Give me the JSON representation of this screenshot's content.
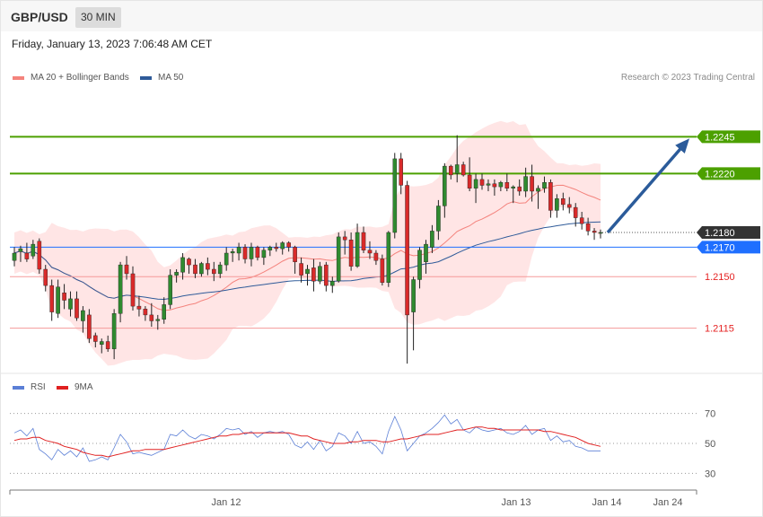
{
  "header": {
    "symbol": "GBP/USD",
    "timeframe": "30 MIN"
  },
  "datetime": "Friday, January 13, 2023 7:06:48 AM CET",
  "legend_main": [
    {
      "label": "MA 20 + Bollinger Bands",
      "color": "#f4837d"
    },
    {
      "label": "MA 50",
      "color": "#2f5b99"
    }
  ],
  "legend_rsi": [
    {
      "label": "RSI",
      "color": "#5b7fd6"
    },
    {
      "label": "9MA",
      "color": "#e02020"
    }
  ],
  "copyright": "Research © 2023 Trading Central",
  "colors": {
    "up": "#2f8a2f",
    "down": "#d92a2a",
    "resistance": "#4ca000",
    "pivot": "#333333",
    "current": "#1f6fff",
    "support": "#e52222",
    "band": "#ffe1e1",
    "arrow": "#2b5b9a"
  },
  "chart_data": [
    {
      "type": "candlestick",
      "ylim": [
        1.2088,
        1.2272
      ],
      "levels": [
        {
          "value": 1.2245,
          "label": "1.2245",
          "role": "resistance"
        },
        {
          "value": 1.222,
          "label": "1.2220",
          "role": "resistance"
        },
        {
          "value": 1.218,
          "label": "1.2180",
          "role": "pivot"
        },
        {
          "value": 1.217,
          "label": "1.2170",
          "role": "current"
        },
        {
          "value": 1.215,
          "label": "1.2150",
          "role": "support"
        },
        {
          "value": 1.2115,
          "label": "1.2115",
          "role": "support"
        }
      ],
      "x_ticks": [
        "Jan 12",
        "Jan 13",
        "Jan 14",
        "Jan 24"
      ],
      "forecast": {
        "from": 1.218,
        "to": 1.2245
      },
      "candles": [
        [
          1.2161,
          1.217,
          1.2157,
          1.2166
        ],
        [
          1.2167,
          1.2171,
          1.216,
          1.2169
        ],
        [
          1.2166,
          1.2173,
          1.216,
          1.2162
        ],
        [
          1.2164,
          1.2175,
          1.2162,
          1.2172
        ],
        [
          1.2174,
          1.2176,
          1.2152,
          1.2155
        ],
        [
          1.2155,
          1.2158,
          1.214,
          1.2144
        ],
        [
          1.2144,
          1.2148,
          1.212,
          1.2126
        ],
        [
          1.2125,
          1.2148,
          1.2122,
          1.2143
        ],
        [
          1.2139,
          1.2145,
          1.2128,
          1.2134
        ],
        [
          1.2128,
          1.214,
          1.2123,
          1.2135
        ],
        [
          1.2135,
          1.214,
          1.212,
          1.2122
        ],
        [
          1.212,
          1.213,
          1.2112,
          1.2127
        ],
        [
          1.2124,
          1.2128,
          1.2105,
          1.2108
        ],
        [
          1.211,
          1.2112,
          1.2102,
          1.2106
        ],
        [
          1.2104,
          1.2108,
          1.2098,
          1.2106
        ],
        [
          1.2106,
          1.211,
          1.2099,
          1.2101
        ],
        [
          1.2101,
          1.2128,
          1.2094,
          1.2125
        ],
        [
          1.2125,
          1.216,
          1.2119,
          1.2158
        ],
        [
          1.2158,
          1.2164,
          1.2148,
          1.2152
        ],
        [
          1.2152,
          1.2157,
          1.2127,
          1.213
        ],
        [
          1.213,
          1.2137,
          1.2123,
          1.2128
        ],
        [
          1.2128,
          1.213,
          1.212,
          1.2124
        ],
        [
          1.2124,
          1.2132,
          1.2116,
          1.212
        ],
        [
          1.212,
          1.2124,
          1.2114,
          1.2121
        ],
        [
          1.2121,
          1.2136,
          1.2118,
          1.2131
        ],
        [
          1.2131,
          1.2155,
          1.2128,
          1.2151
        ],
        [
          1.2151,
          1.2155,
          1.2146,
          1.2153
        ],
        [
          1.2153,
          1.2166,
          1.2148,
          1.2163
        ],
        [
          1.2162,
          1.2163,
          1.2152,
          1.2158
        ],
        [
          1.2158,
          1.2162,
          1.2149,
          1.2152
        ],
        [
          1.2152,
          1.216,
          1.215,
          1.2159
        ],
        [
          1.2159,
          1.2163,
          1.2151,
          1.2155
        ],
        [
          1.2155,
          1.216,
          1.2147,
          1.2152
        ],
        [
          1.2152,
          1.216,
          1.2149,
          1.2158
        ],
        [
          1.2158,
          1.217,
          1.2154,
          1.2166
        ],
        [
          1.2166,
          1.2169,
          1.216,
          1.2167
        ],
        [
          1.2166,
          1.2173,
          1.2161,
          1.217
        ],
        [
          1.217,
          1.2172,
          1.2159,
          1.2162
        ],
        [
          1.2162,
          1.2173,
          1.2157,
          1.217
        ],
        [
          1.217,
          1.2171,
          1.2161,
          1.2163
        ],
        [
          1.2163,
          1.217,
          1.2158,
          1.2168
        ],
        [
          1.2168,
          1.2171,
          1.2164,
          1.217
        ],
        [
          1.217,
          1.2173,
          1.2167,
          1.2169
        ],
        [
          1.2169,
          1.2174,
          1.2165,
          1.2173
        ],
        [
          1.2173,
          1.2174,
          1.2167,
          1.217
        ],
        [
          1.217,
          1.2171,
          1.2152,
          1.216
        ],
        [
          1.2159,
          1.2163,
          1.2146,
          1.2151
        ],
        [
          1.2152,
          1.2158,
          1.2144,
          1.2155
        ],
        [
          1.2156,
          1.2162,
          1.214,
          1.2147
        ],
        [
          1.2147,
          1.216,
          1.2145,
          1.2157
        ],
        [
          1.2158,
          1.216,
          1.214,
          1.2144
        ],
        [
          1.2144,
          1.215,
          1.2139,
          1.2147
        ],
        [
          1.2147,
          1.218,
          1.2146,
          1.2177
        ],
        [
          1.2177,
          1.2181,
          1.2165,
          1.2175
        ],
        [
          1.2175,
          1.218,
          1.2154,
          1.2157
        ],
        [
          1.2157,
          1.2186,
          1.2156,
          1.218
        ],
        [
          1.218,
          1.2184,
          1.2166,
          1.2168
        ],
        [
          1.2168,
          1.2174,
          1.2162,
          1.2166
        ],
        [
          1.2166,
          1.2168,
          1.2158,
          1.2161
        ],
        [
          1.2162,
          1.2165,
          1.2144,
          1.2146
        ],
        [
          1.2146,
          1.2181,
          1.2143,
          1.218
        ],
        [
          1.218,
          1.2234,
          1.2176,
          1.223
        ],
        [
          1.223,
          1.2234,
          1.2206,
          1.2212
        ],
        [
          1.2212,
          1.2215,
          1.2091,
          1.2124
        ],
        [
          1.2126,
          1.215,
          1.21,
          1.2148
        ],
        [
          1.2148,
          1.217,
          1.2142,
          1.2168
        ],
        [
          1.216,
          1.2175,
          1.2152,
          1.2172
        ],
        [
          1.217,
          1.2185,
          1.2166,
          1.2181
        ],
        [
          1.2181,
          1.2202,
          1.2175,
          1.2198
        ],
        [
          1.2198,
          1.2227,
          1.219,
          1.2225
        ],
        [
          1.2225,
          1.2226,
          1.2216,
          1.2219
        ],
        [
          1.222,
          1.2246,
          1.2214,
          1.2226
        ],
        [
          1.2226,
          1.2228,
          1.2218,
          1.2219
        ],
        [
          1.2219,
          1.2231,
          1.2208,
          1.221
        ],
        [
          1.221,
          1.222,
          1.22,
          1.2216
        ],
        [
          1.2216,
          1.222,
          1.2209,
          1.2212
        ],
        [
          1.2212,
          1.2216,
          1.2208,
          1.2213
        ],
        [
          1.2213,
          1.2216,
          1.2205,
          1.2211
        ],
        [
          1.2211,
          1.2215,
          1.2208,
          1.2214
        ],
        [
          1.2214,
          1.222,
          1.2208,
          1.221
        ],
        [
          1.221,
          1.2212,
          1.22,
          1.2211
        ],
        [
          1.2211,
          1.2216,
          1.2205,
          1.2208
        ],
        [
          1.2208,
          1.2224,
          1.2204,
          1.2218
        ],
        [
          1.2218,
          1.2226,
          1.2201,
          1.2208
        ],
        [
          1.2208,
          1.2212,
          1.2196,
          1.221
        ],
        [
          1.221,
          1.2218,
          1.2207,
          1.2214
        ],
        [
          1.2214,
          1.2216,
          1.219,
          1.2195
        ],
        [
          1.2195,
          1.2206,
          1.219,
          1.2203
        ],
        [
          1.2203,
          1.2207,
          1.2195,
          1.2199
        ],
        [
          1.2199,
          1.2204,
          1.2193,
          1.2197
        ],
        [
          1.2197,
          1.22,
          1.2184,
          1.219
        ],
        [
          1.219,
          1.2194,
          1.2182,
          1.2186
        ],
        [
          1.2186,
          1.219,
          1.2178,
          1.2181
        ],
        [
          1.2181,
          1.2183,
          1.2175,
          1.218
        ],
        [
          1.218,
          1.2182,
          1.2176,
          1.218
        ]
      ]
    },
    {
      "type": "line",
      "title": "RSI",
      "ylim": [
        20,
        80
      ],
      "y_ticks": [
        70,
        50,
        30
      ],
      "series": [
        {
          "name": "RSI",
          "values": [
            57,
            59,
            55,
            60,
            46,
            43,
            39,
            46,
            42,
            45,
            41,
            47,
            38,
            39,
            41,
            39,
            47,
            56,
            51,
            43,
            44,
            43,
            42,
            44,
            46,
            56,
            55,
            59,
            55,
            53,
            56,
            55,
            53,
            56,
            60,
            59,
            60,
            56,
            58,
            54,
            57,
            58,
            57,
            58,
            56,
            49,
            47,
            51,
            46,
            52,
            45,
            48,
            57,
            55,
            50,
            58,
            50,
            51,
            48,
            43,
            58,
            68,
            59,
            45,
            50,
            55,
            57,
            60,
            64,
            69,
            63,
            66,
            59,
            57,
            61,
            59,
            58,
            59,
            60,
            57,
            56,
            58,
            62,
            56,
            59,
            60,
            52,
            55,
            51,
            52,
            48,
            47,
            45,
            45,
            45
          ]
        },
        {
          "name": "9MA",
          "values": [
            52,
            53,
            53,
            54,
            54,
            52,
            51,
            50,
            48,
            47,
            46,
            44,
            43,
            42,
            42,
            41,
            42,
            43,
            44,
            45,
            45,
            46,
            46,
            46,
            46,
            47,
            48,
            49,
            50,
            51,
            52,
            53,
            54,
            55,
            55,
            56,
            56,
            57,
            57,
            57,
            57,
            57,
            57,
            57,
            57,
            56,
            55,
            55,
            53,
            52,
            51,
            50,
            50,
            50,
            51,
            51,
            52,
            52,
            52,
            51,
            51,
            52,
            53,
            53,
            54,
            55,
            56,
            56,
            56,
            57,
            58,
            59,
            59,
            60,
            61,
            61,
            60,
            60,
            59,
            59,
            59,
            59,
            59,
            59,
            59,
            58,
            58,
            57,
            56,
            55,
            54,
            52,
            50,
            49,
            48
          ]
        }
      ]
    }
  ]
}
